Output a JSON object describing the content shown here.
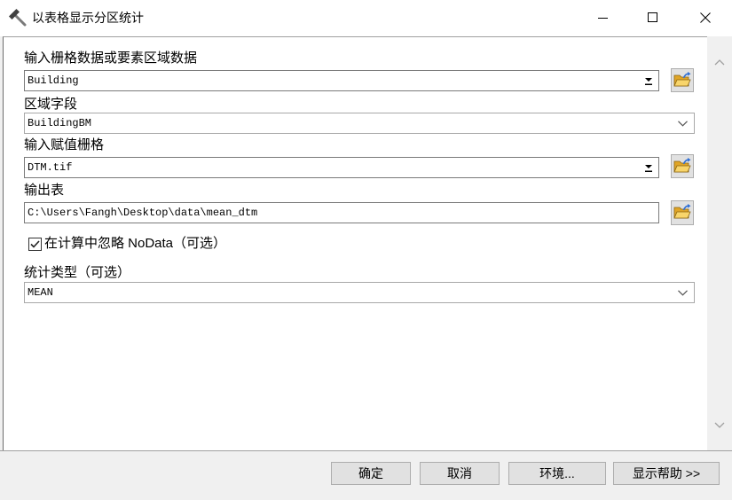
{
  "window": {
    "title": "以表格显示分区统计",
    "icon": "hammer-icon",
    "controls": [
      "minimize-icon",
      "maximize-icon",
      "close-icon"
    ]
  },
  "parameters": {
    "input_zone_data": {
      "label": "输入栅格数据或要素区域数据",
      "value": "Building",
      "icons": [
        "dropdown-arrow-icon",
        "open-folder-icon"
      ]
    },
    "zone_field": {
      "label": "区域字段",
      "value": "BuildingBM",
      "icons": [
        "chevron-down-icon"
      ]
    },
    "input_value_raster": {
      "label": "输入赋值栅格",
      "value": "DTM.tif",
      "icons": [
        "dropdown-arrow-icon",
        "open-folder-icon"
      ]
    },
    "output_table": {
      "label": "输出表",
      "value": "C:\\Users\\Fangh\\Desktop\\data\\mean_dtm",
      "icons": [
        "open-folder-icon"
      ]
    },
    "ignore_nodata": {
      "label": "在计算中忽略 NoData（可选）",
      "checked": true
    },
    "statistics_type": {
      "label": "统计类型（可选）",
      "value": "MEAN",
      "icons": [
        "chevron-down-icon"
      ]
    }
  },
  "scrollbar": {
    "icons": [
      "chevron-up-icon",
      "chevron-down-icon"
    ]
  },
  "buttons": {
    "ok": "确定",
    "cancel": "取消",
    "environments": "环境...",
    "show_help": "显示帮助 >>"
  },
  "colors": {
    "panel_bg": "#ffffff",
    "chrome_bg": "#f0f0f0",
    "button_bg": "#e1e1e1",
    "button_border": "#adadad",
    "folder": "#f8d56b",
    "folder_arrow": "#2f6fd6"
  }
}
